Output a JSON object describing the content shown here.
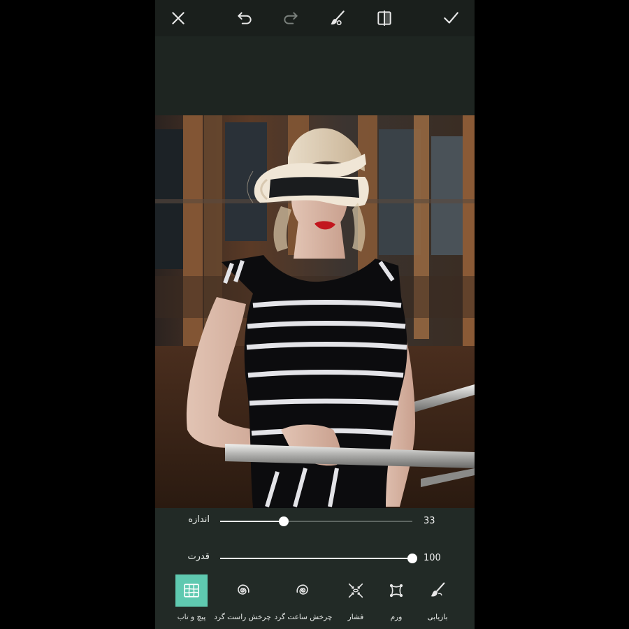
{
  "toolbar": {
    "icons": [
      "close-icon",
      "undo-icon",
      "redo-icon",
      "brush-icon",
      "compare-icon",
      "checkmark-icon"
    ]
  },
  "sliders": {
    "size": {
      "label": "اندازه",
      "value": "33",
      "fraction": 0.33
    },
    "strength": {
      "label": "قدرت",
      "value": "100",
      "fraction": 1.0
    }
  },
  "tools": {
    "twirl": {
      "label": "پیچ و تاب",
      "icon": "warp-grid-icon",
      "active": true
    },
    "rotate_cw": {
      "label": "چرخش راست گرد",
      "icon": "swirl-cw-icon"
    },
    "rotate_ccw": {
      "label": "چرخش ساعت گرد",
      "icon": "swirl-ccw-icon"
    },
    "pinch": {
      "label": "فشار",
      "icon": "pinch-icon"
    },
    "bloat": {
      "label": "ورم",
      "icon": "bloat-icon"
    },
    "restore": {
      "label": "بازیابی",
      "icon": "restore-brush-icon"
    }
  },
  "colors": {
    "accent": "#5fc9b0",
    "panel": "#222a26",
    "toolbar": "#1a1f1c"
  }
}
